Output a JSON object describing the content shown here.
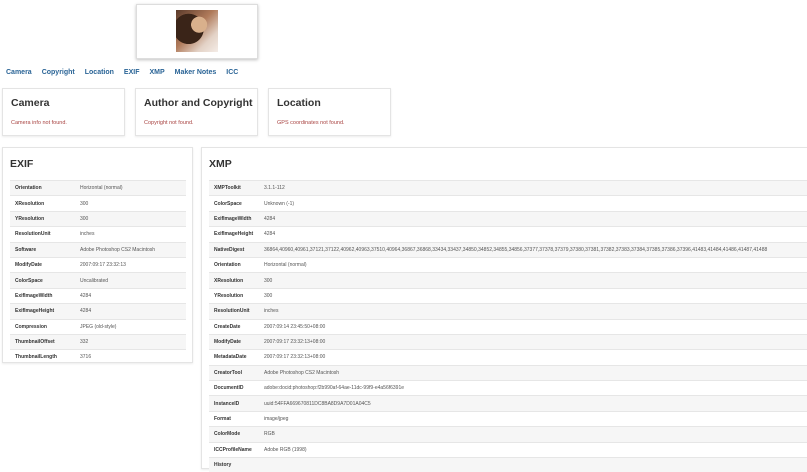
{
  "nav": [
    {
      "label": "Camera"
    },
    {
      "label": "Copyright"
    },
    {
      "label": "Location"
    },
    {
      "label": "EXIF"
    },
    {
      "label": "XMP"
    },
    {
      "label": "Maker Notes"
    },
    {
      "label": "ICC"
    }
  ],
  "camera": {
    "title": "Camera",
    "message": "Camera info not found."
  },
  "copyright": {
    "title": "Author and Copyright",
    "message": "Copyright not found."
  },
  "location": {
    "title": "Location",
    "message": "GPS coordinates not found."
  },
  "exif": {
    "title": "EXIF",
    "rows": [
      {
        "key": "Orientation",
        "value": "Horizontal (normal)"
      },
      {
        "key": "XResolution",
        "value": "300"
      },
      {
        "key": "YResolution",
        "value": "300"
      },
      {
        "key": "ResolutionUnit",
        "value": "inches"
      },
      {
        "key": "Software",
        "value": "Adobe Photoshop CS2 Macintosh"
      },
      {
        "key": "ModifyDate",
        "value": "2007:09:17 23:32:13"
      },
      {
        "key": "ColorSpace",
        "value": "Uncalibrated"
      },
      {
        "key": "ExifImageWidth",
        "value": "4284"
      },
      {
        "key": "ExifImageHeight",
        "value": "4284"
      },
      {
        "key": "Compression",
        "value": "JPEG (old-style)"
      },
      {
        "key": "ThumbnailOffset",
        "value": "332"
      },
      {
        "key": "ThumbnailLength",
        "value": "3716"
      }
    ]
  },
  "xmp": {
    "title": "XMP",
    "rows": [
      {
        "key": "XMPToolkit",
        "value": "3.1.1-112"
      },
      {
        "key": "ColorSpace",
        "value": "Unknown (-1)"
      },
      {
        "key": "ExifImageWidth",
        "value": "4284"
      },
      {
        "key": "ExifImageHeight",
        "value": "4284"
      },
      {
        "key": "NativeDigest",
        "value": "36864,40960,40961,37121,37122,40962,40963,37510,40964,36867,36868,33434,33437,34850,34852,34855,34856,37377,37378,37379,37380,37381,37382,37383,37384,37385,37386,37396,41483,41484,41486,41487,41488"
      },
      {
        "key": "Orientation",
        "value": "Horizontal (normal)"
      },
      {
        "key": "XResolution",
        "value": "300"
      },
      {
        "key": "YResolution",
        "value": "300"
      },
      {
        "key": "ResolutionUnit",
        "value": "inches"
      },
      {
        "key": "CreateDate",
        "value": "2007:09:14 23:45:50+08:00"
      },
      {
        "key": "ModifyDate",
        "value": "2007:09:17 23:32:13+08:00"
      },
      {
        "key": "MetadataDate",
        "value": "2007:09:17 23:32:13+08:00"
      },
      {
        "key": "CreatorTool",
        "value": "Adobe Photoshop CS2 Macintosh"
      },
      {
        "key": "DocumentID",
        "value": "adobe:docid:photoshop:f2b990af-64ae-11dc-99f9-e4a56f6391e"
      },
      {
        "key": "InstanceID",
        "value": "uuid:54FFA669670811DC8BA8D9A7D01A04C5"
      },
      {
        "key": "Format",
        "value": "image/jpeg"
      },
      {
        "key": "ColorMode",
        "value": "RGB"
      },
      {
        "key": "ICCProfileName",
        "value": "Adobe RGB (1998)"
      },
      {
        "key": "History",
        "value": ""
      }
    ]
  }
}
